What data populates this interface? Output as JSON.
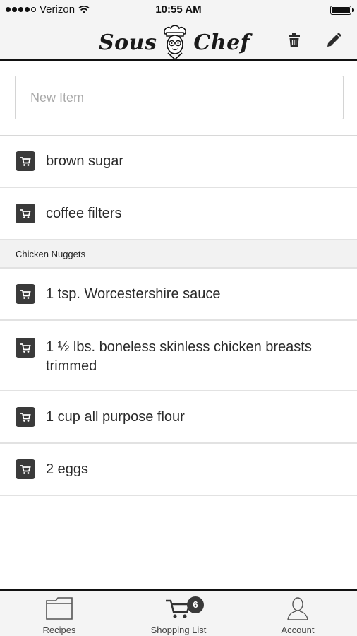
{
  "status_bar": {
    "carrier": "Verizon",
    "time": "10:55 AM",
    "signal_icon": "signal-dots-icon",
    "wifi_icon": "wifi-icon",
    "battery_icon": "battery-icon"
  },
  "header": {
    "logo_left": "Sous",
    "logo_right": "Chef",
    "trash_icon": "trash-icon",
    "edit_icon": "pencil-icon"
  },
  "new_item": {
    "placeholder": "New Item",
    "value": ""
  },
  "list": {
    "items": [
      {
        "label": "brown sugar",
        "icon": "cart-icon"
      },
      {
        "label": "coffee filters",
        "icon": "cart-icon"
      }
    ],
    "section": {
      "title": "Chicken Nuggets",
      "items": [
        {
          "label": "1 tsp. Worcestershire sauce",
          "icon": "cart-icon"
        },
        {
          "label": "1 ½ lbs. boneless skinless chicken breasts trimmed",
          "icon": "cart-icon"
        },
        {
          "label": "1 cup all purpose flour",
          "icon": "cart-icon"
        },
        {
          "label": "2 eggs",
          "icon": "cart-icon"
        }
      ]
    }
  },
  "tabs": [
    {
      "label": "Recipes",
      "icon": "folder-icon"
    },
    {
      "label": "Shopping List",
      "icon": "cart-icon",
      "badge": "6"
    },
    {
      "label": "Account",
      "icon": "person-icon"
    }
  ],
  "colors": {
    "accent": "#3a3a3a",
    "bar_background": "#f4f4f4",
    "divider": "#e2e2e2"
  }
}
